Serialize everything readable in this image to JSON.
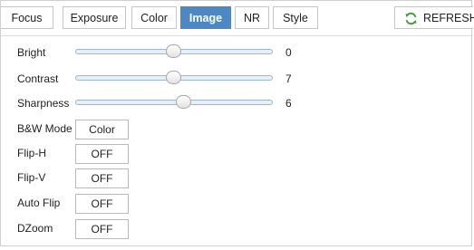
{
  "tabs": [
    {
      "label": "Focus",
      "active": false
    },
    {
      "label": "Exposure",
      "active": false
    },
    {
      "label": "Color",
      "active": false
    },
    {
      "label": "Image",
      "active": true
    },
    {
      "label": "NR",
      "active": false
    },
    {
      "label": "Style",
      "active": false
    }
  ],
  "refresh": {
    "label": "REFRESH",
    "icon": "refresh-icon",
    "icon_color": "#3f9a3a"
  },
  "colors": {
    "active_tab": "#4d88c4"
  },
  "sliders": {
    "bright": {
      "label": "Bright",
      "value": "0",
      "position_fraction": 0.5
    },
    "contrast": {
      "label": "Contrast",
      "value": "7",
      "position_fraction": 0.5
    },
    "sharpness": {
      "label": "Sharpness",
      "value": "6",
      "position_fraction": 0.55
    }
  },
  "toggles": {
    "bw_mode": {
      "label": "B&W Mode",
      "value": "Color"
    },
    "flip_h": {
      "label": "Flip-H",
      "value": "OFF"
    },
    "flip_v": {
      "label": "Flip-V",
      "value": "OFF"
    },
    "auto_flip": {
      "label": "Auto Flip",
      "value": "OFF"
    },
    "dzoom": {
      "label": "DZoom",
      "value": "OFF"
    }
  }
}
